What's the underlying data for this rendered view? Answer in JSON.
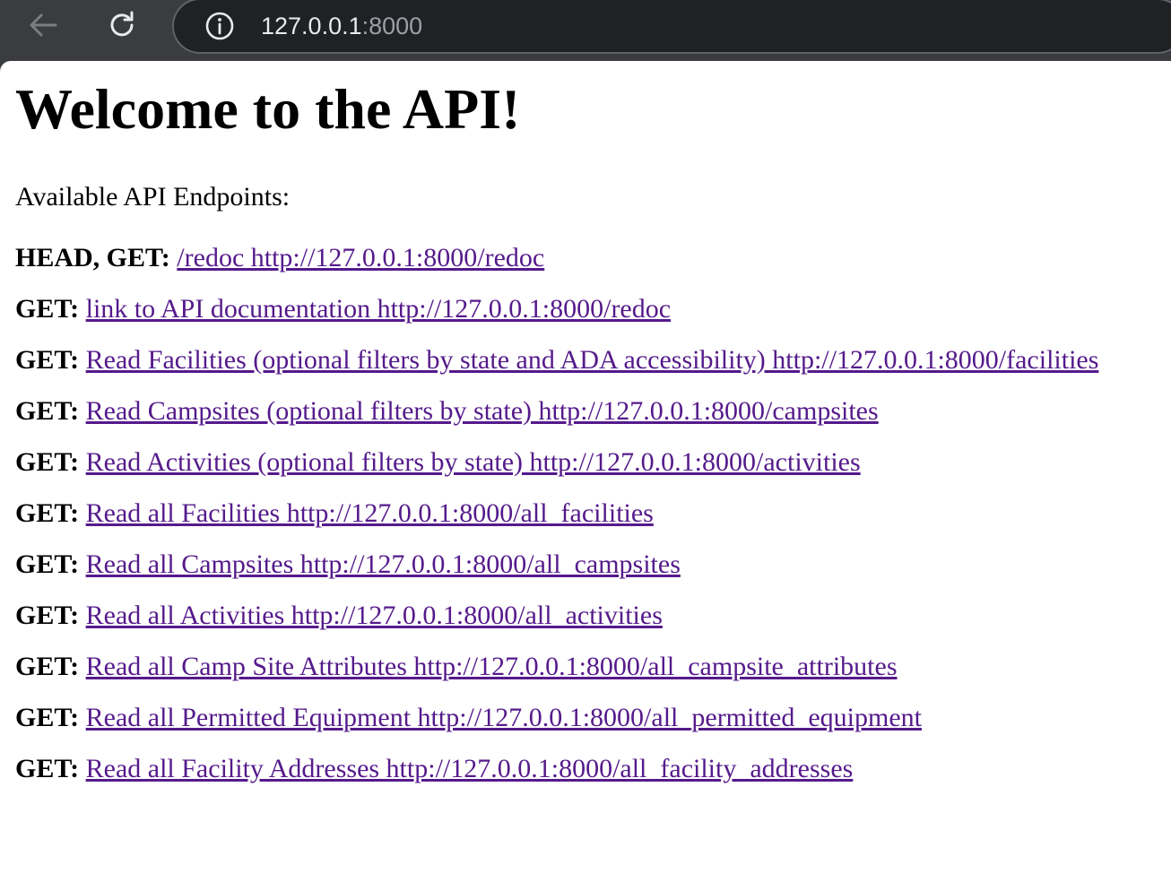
{
  "browser": {
    "url_host": "127.0.0.1",
    "url_port": ":8000",
    "icons": {
      "back": "back-arrow-icon",
      "reload": "reload-icon",
      "info": "info-icon"
    }
  },
  "page": {
    "title": "Welcome to the API!",
    "intro": "Available API Endpoints:",
    "endpoints": [
      {
        "method": "HEAD, GET:",
        "link": "/redoc http://127.0.0.1:8000/redoc"
      },
      {
        "method": "GET:",
        "link": "link to API documentation http://127.0.0.1:8000/redoc"
      },
      {
        "method": "GET:",
        "link": "Read Facilities (optional filters by state and ADA accessibility) http://127.0.0.1:8000/facilities"
      },
      {
        "method": "GET:",
        "link": "Read Campsites (optional filters by state) http://127.0.0.1:8000/campsites"
      },
      {
        "method": "GET:",
        "link": "Read Activities (optional filters by state) http://127.0.0.1:8000/activities"
      },
      {
        "method": "GET:",
        "link": "Read all Facilities http://127.0.0.1:8000/all_facilities"
      },
      {
        "method": "GET:",
        "link": "Read all Campsites http://127.0.0.1:8000/all_campsites"
      },
      {
        "method": "GET:",
        "link": "Read all Activities http://127.0.0.1:8000/all_activities"
      },
      {
        "method": "GET:",
        "link": "Read all Camp Site Attributes http://127.0.0.1:8000/all_campsite_attributes"
      },
      {
        "method": "GET:",
        "link": "Read all Permitted Equipment http://127.0.0.1:8000/all_permitted_equipment"
      },
      {
        "method": "GET:",
        "link": "Read all Facility Addresses http://127.0.0.1:8000/all_facility_addresses"
      }
    ]
  },
  "colors": {
    "toolbar": "#3b3c3f",
    "omnibox": "#202124",
    "visited_link": "#551a8b"
  }
}
